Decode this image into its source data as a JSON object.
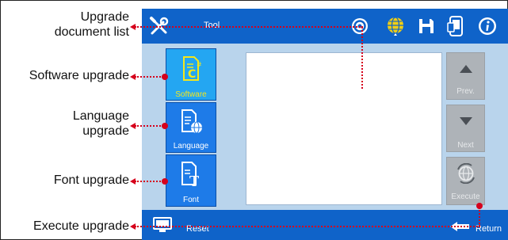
{
  "annotations": {
    "upgrade_document_list": [
      "Upgrade",
      "document list"
    ],
    "software_upgrade": "Software upgrade",
    "language_upgrade": [
      "Language",
      "upgrade"
    ],
    "font_upgrade": "Font upgrade",
    "execute_upgrade": "Execute upgrade"
  },
  "screen": {
    "title": "Tool",
    "menu": [
      {
        "label": "Software",
        "icon": "software-upgrade-icon",
        "selected": true
      },
      {
        "label": "Language",
        "icon": "language-upgrade-icon",
        "selected": false
      },
      {
        "label": "Font",
        "icon": "font-upgrade-icon",
        "selected": false
      }
    ],
    "side_buttons": {
      "prev": "Prev.",
      "next": "Next",
      "execute": "Execute"
    },
    "bottom": {
      "reset": "Reset",
      "return": "Return"
    },
    "header_icons": [
      "tool-icon",
      "settings-icon",
      "globe-icon",
      "save-icon",
      "phone-icon",
      "info-icon"
    ]
  },
  "colors": {
    "bar_blue": "#0f63c9",
    "screen_bg": "#b9d4ec",
    "menu_button": "#1e7be8",
    "menu_button_selected": "#24a6f2",
    "side_button": "#aeb3b8",
    "annotation_red": "#d6001c",
    "software_icon_yellow": "#f5e61a"
  }
}
